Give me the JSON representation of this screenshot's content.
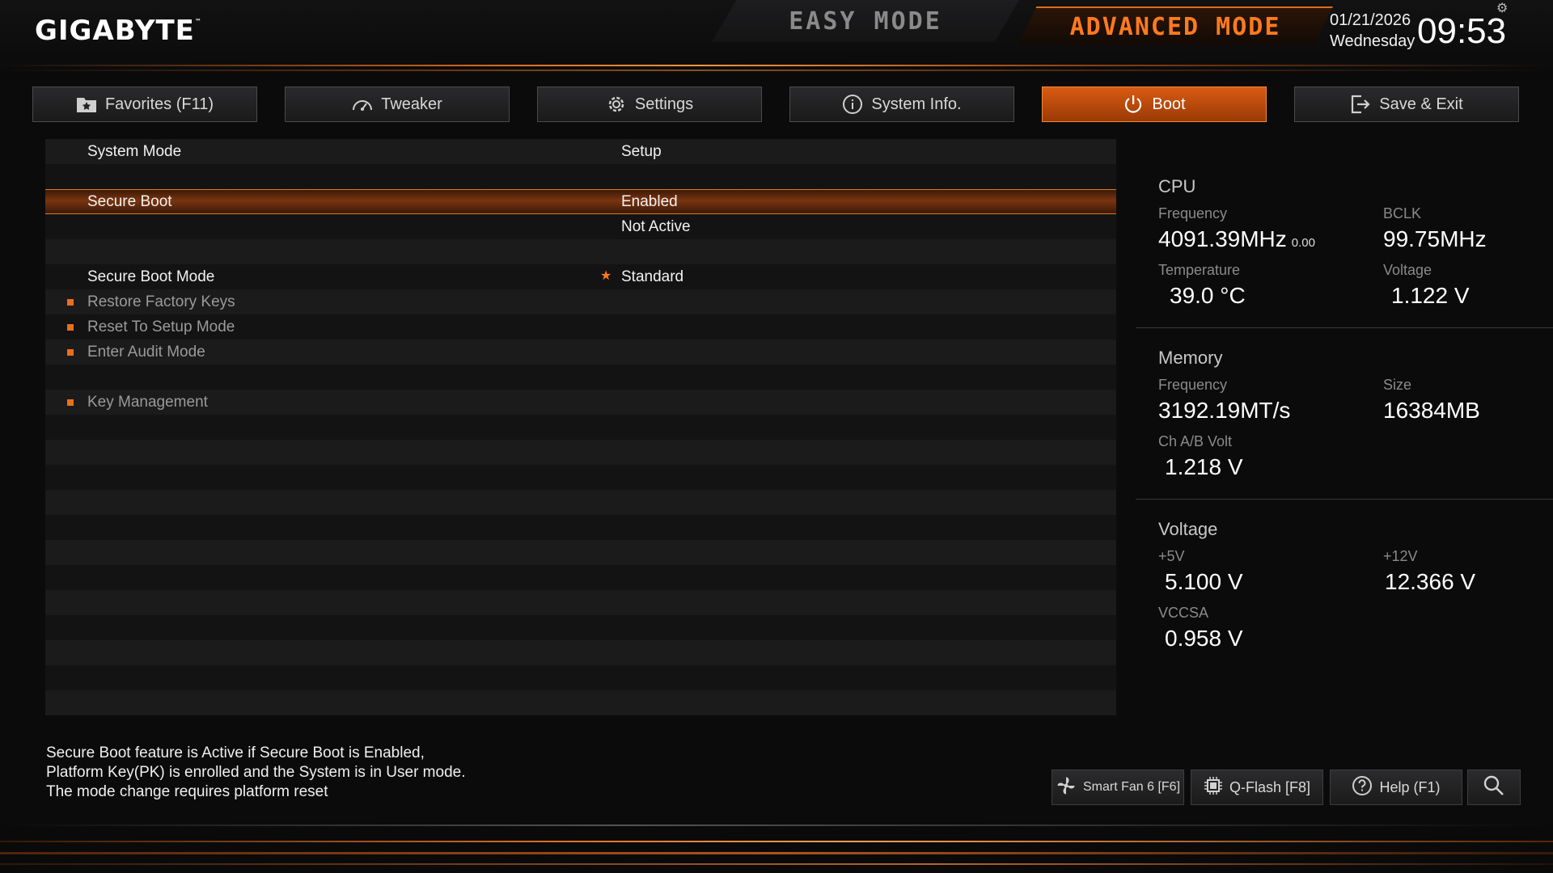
{
  "brand": {
    "logo": "GIGABYTE",
    "trademark": "™"
  },
  "modes": {
    "easy": "EASY MODE",
    "advanced": "ADVANCED MODE"
  },
  "datetime": {
    "date": "01/21/2026",
    "weekday": "Wednesday",
    "time": "09:53"
  },
  "tabs": [
    {
      "label": "Favorites (F11)",
      "icon": "star-folder-icon"
    },
    {
      "label": "Tweaker",
      "icon": "speedometer-icon"
    },
    {
      "label": "Settings",
      "icon": "gear-icon"
    },
    {
      "label": "System Info.",
      "icon": "info-icon"
    },
    {
      "label": "Boot",
      "icon": "power-icon",
      "active": true
    },
    {
      "label": "Save & Exit",
      "icon": "exit-icon"
    }
  ],
  "settings": {
    "system_mode": {
      "label": "System Mode",
      "value": "Setup"
    },
    "secure_boot": {
      "label": "Secure Boot",
      "value": "Enabled",
      "status": "Not Active"
    },
    "secure_boot_mode": {
      "label": "Secure Boot Mode",
      "value": "Standard"
    },
    "restore_factory_keys": "Restore Factory Keys",
    "reset_to_setup_mode": "Reset To Setup Mode",
    "enter_audit_mode": "Enter Audit Mode",
    "key_management": "Key Management"
  },
  "help": {
    "line1": "Secure Boot feature is Active if Secure Boot is Enabled,",
    "line2": "Platform Key(PK) is enrolled and the System is in User mode.",
    "line3": "The mode change requires platform reset"
  },
  "info": {
    "cpu": {
      "title": "CPU",
      "frequency_label": "Frequency",
      "frequency": "4091.39MHz",
      "frequency_sub": "0.00",
      "bclk_label": "BCLK",
      "bclk": "99.75MHz",
      "temperature_label": "Temperature",
      "temperature": "39.0 °C",
      "voltage_label": "Voltage",
      "voltage": "1.122 V"
    },
    "memory": {
      "title": "Memory",
      "frequency_label": "Frequency",
      "frequency": "3192.19MT/s",
      "size_label": "Size",
      "size": "16384MB",
      "volt_label": "Ch A/B Volt",
      "volt": "1.218 V"
    },
    "voltage": {
      "title": "Voltage",
      "p5_label": "+5V",
      "p5": "5.100 V",
      "p12_label": "+12V",
      "p12": "12.366 V",
      "vccsa_label": "VCCSA",
      "vccsa": "0.958 V"
    }
  },
  "bottom_buttons": {
    "smart_fan": "Smart Fan 6 [F6]",
    "qflash": "Q-Flash [F8]",
    "help": "Help (F1)"
  },
  "colors": {
    "accent": "#ff7a1e",
    "active_tab": "#d95b12",
    "background": "#0b0b0c"
  }
}
